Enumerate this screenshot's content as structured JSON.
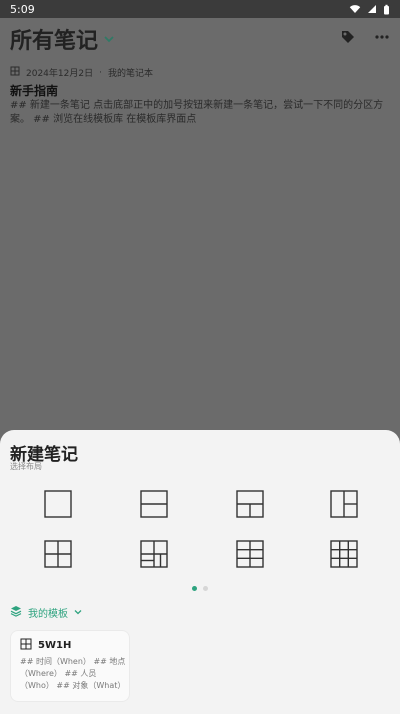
{
  "status": {
    "time": "5:09"
  },
  "app": {
    "title": "所有笔记"
  },
  "note": {
    "date": "2024年12月2日",
    "separator": "·",
    "notebook": "我的笔记本",
    "title": "新手指南",
    "body": "## 新建一条笔记 点击底部正中的加号按钮来新建一条笔记，尝试一下不同的分区方案。 ## 浏览在线模板库 在模板库界面点"
  },
  "sheet": {
    "title": "新建笔记",
    "subtitle": "选择布局",
    "layouts": [
      "single",
      "two-rows",
      "top-split",
      "right-split",
      "four",
      "quad-split",
      "six",
      "nine"
    ],
    "page_dots": [
      true,
      false
    ],
    "my_templates_label": "我的模板",
    "template": {
      "name": "5W1H",
      "body": "## 时间（When） ## 地点（Where） ## 人员（Who） ## 对象（What）"
    }
  },
  "colors": {
    "accent": "#2ea37f"
  }
}
